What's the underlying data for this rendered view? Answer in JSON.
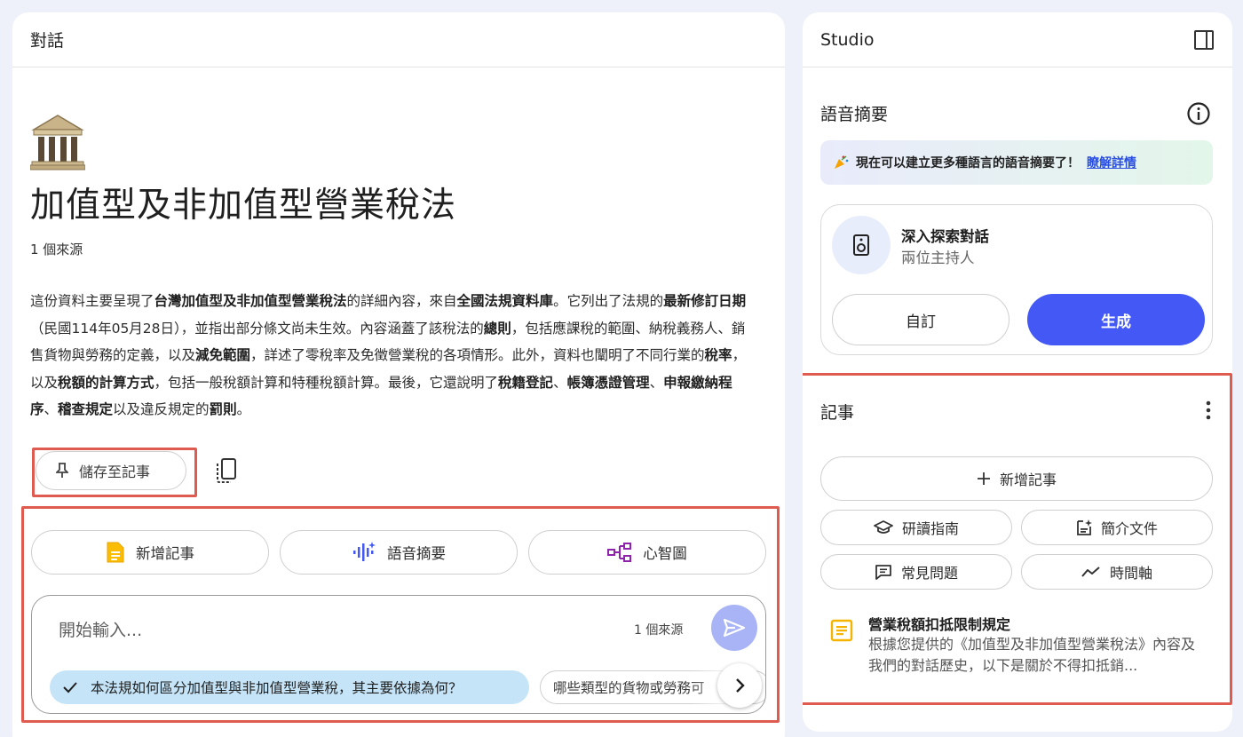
{
  "chat": {
    "header": "對話",
    "title": "加值型及非加值型營業稅法",
    "source_count": "1 個來源",
    "summary": {
      "s1": "這份資料主要呈現了",
      "b1": "台灣加值型及非加值型營業稅法",
      "s2": "的詳細內容，來自",
      "b2": "全國法規資料庫",
      "s3": "。它列出了法規的",
      "b3": "最新修訂日期",
      "s4": "（民國114年05月28日），並指出部分條文尚未生效。內容涵蓋了該稅法的",
      "b4": "總則",
      "s5": "，包括應課稅的範圍、納稅義務人、銷售貨物與勞務的定義，以及",
      "b5": "減免範圍",
      "s6": "，詳述了零稅率及免徵營業稅的各項情形。此外，資料也闡明了不同行業的",
      "b6": "稅率",
      "s7": "，以及",
      "b7": "稅額的計算方式",
      "s8": "，包括一般稅額計算和特種稅額計算。最後，它還說明了",
      "b8": "稅籍登記",
      "s9": "、",
      "b9": "帳簿憑證管理",
      "s10": "、",
      "b10": "申報繳納程序",
      "s11": "、",
      "b11": "稽查規定",
      "s12": "以及違反規定的",
      "b12": "罰則",
      "s13": "。"
    },
    "save_button": "儲存至記事",
    "actions": {
      "add_note": "新增記事",
      "audio_summary": "語音摘要",
      "mind_map": "心智圖"
    },
    "input": {
      "placeholder": "開始輸入...",
      "source_count": "1 個來源"
    },
    "suggestions": [
      "本法規如何區分加值型與非加值型營業稅，其主要依據為何？",
      "哪些類型的貨物或勞務可"
    ]
  },
  "studio": {
    "header": "Studio",
    "audio_section": {
      "title": "語音摘要",
      "banner_text": "現在可以建立更多種語言的語音摘要了！",
      "banner_link": "瞭解詳情",
      "card_title": "深入探索對話",
      "card_subtitle": "兩位主持人",
      "customize_button": "自訂",
      "generate_button": "生成"
    },
    "notes_section": {
      "title": "記事",
      "add_note": "新增記事",
      "study_guide": "研讀指南",
      "briefing_doc": "簡介文件",
      "faq": "常見問題",
      "timeline": "時間軸",
      "note": {
        "title": "營業稅額扣抵限制規定",
        "body": "根據您提供的《加值型及非加值型營業稅法》內容及我們的對話歷史，以下是關於不得扣抵銷..."
      }
    }
  },
  "colors": {
    "accent": "#4358f5",
    "highlight": "#e05b4f",
    "chip_selected": "#c5e4f7",
    "note_icon": "#f4b400",
    "audio_icon": "#4358f5",
    "mindmap_icon": "#8e24aa"
  },
  "icons": {
    "building": "classical-building-icon",
    "pin": "pin-icon",
    "copy": "copy-icon",
    "note": "note-icon",
    "audio": "audio-wave-icon",
    "mindmap": "mind-map-icon",
    "send": "send-icon",
    "check": "check-icon",
    "chevron": "chevron-right-icon",
    "panel": "panel-toggle-icon",
    "info": "info-icon",
    "speaker": "speaker-icon",
    "more": "more-vert-icon",
    "plus": "plus-icon",
    "graduation": "graduation-cap-icon",
    "doc": "document-icon",
    "faq": "faq-icon",
    "timeline": "timeline-icon",
    "party": "party-popper-icon"
  }
}
